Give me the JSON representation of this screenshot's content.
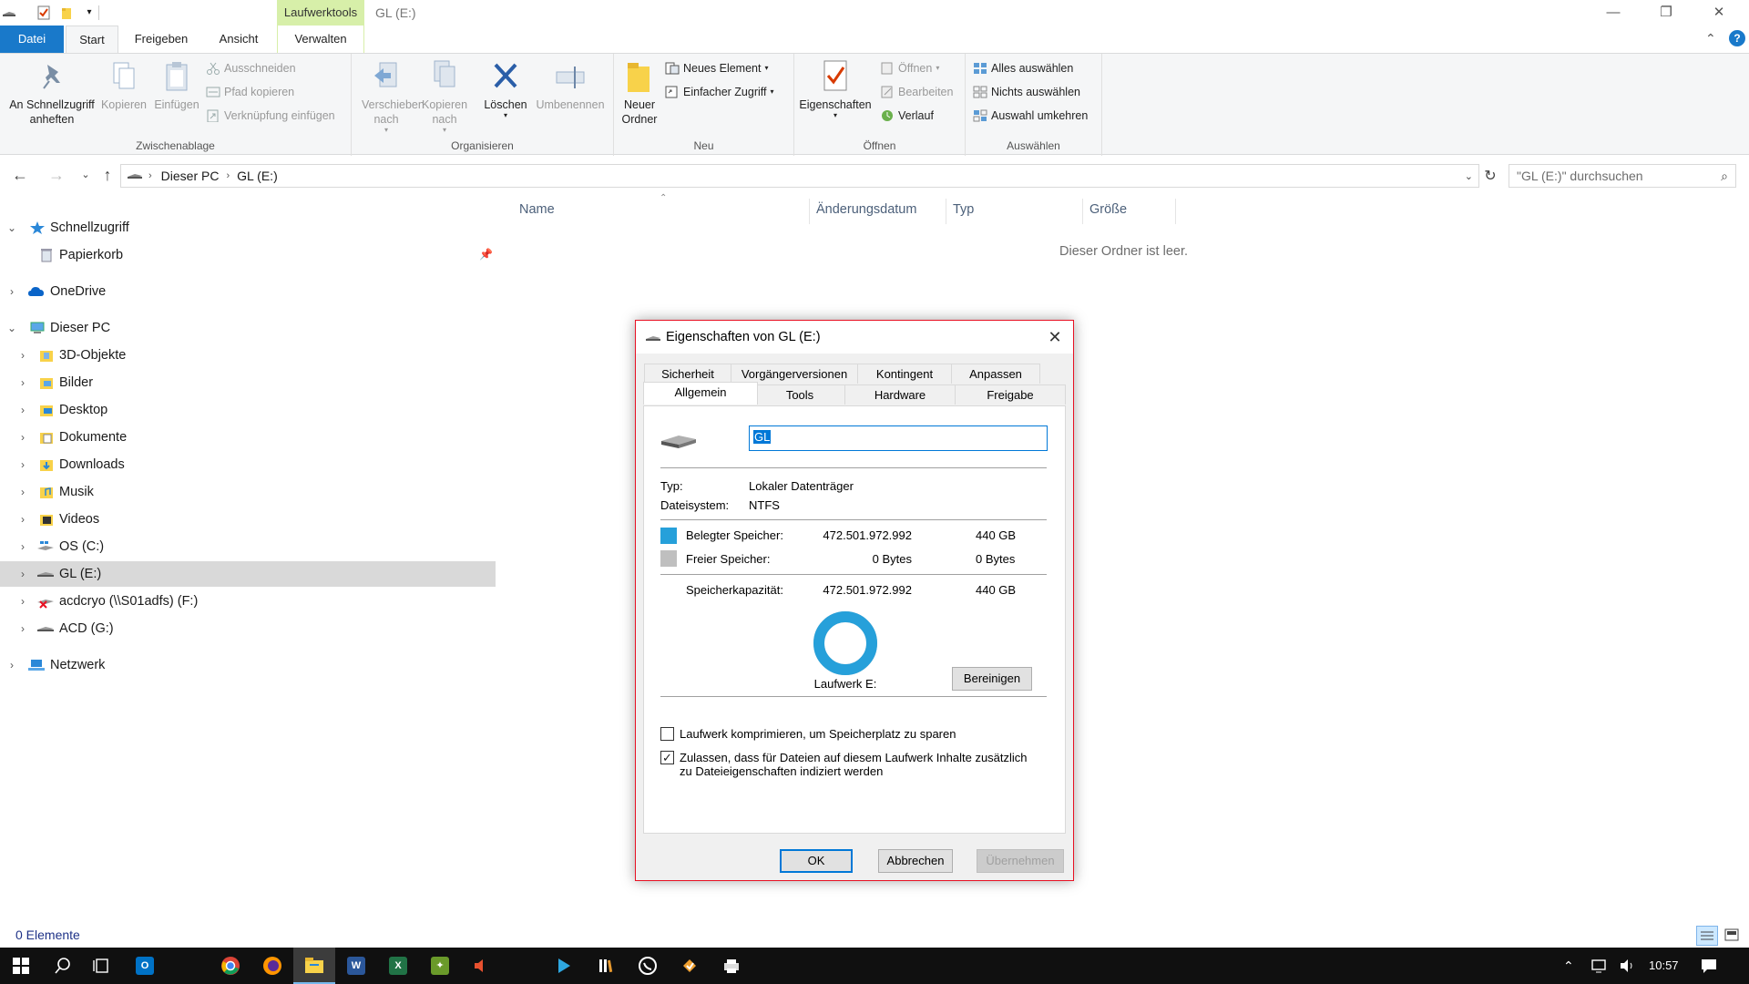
{
  "titlebar": {
    "context_tab": "Laufwerktools",
    "title": "GL (E:)"
  },
  "ribbon_tabs": [
    "Datei",
    "Start",
    "Freigeben",
    "Ansicht",
    "Verwalten"
  ],
  "ribbon": {
    "zwischenablage": {
      "label": "Zwischenablage",
      "pin": "An Schnellzugriff anheften",
      "copy": "Kopieren",
      "paste": "Einfügen",
      "cut": "Ausschneiden",
      "copy_path": "Pfad kopieren",
      "paste_shortcut": "Verknüpfung einfügen"
    },
    "organisieren": {
      "label": "Organisieren",
      "move_to": "Verschieben nach",
      "copy_to": "Kopieren nach",
      "delete": "Löschen",
      "rename": "Umbenennen"
    },
    "neu": {
      "label": "Neu",
      "new_folder": "Neuer Ordner",
      "new_item": "Neues Element",
      "easy_access": "Einfacher Zugriff"
    },
    "oeffnen": {
      "label": "Öffnen",
      "properties": "Eigenschaften",
      "open": "Öffnen",
      "edit": "Bearbeiten",
      "history": "Verlauf"
    },
    "auswaehlen": {
      "label": "Auswählen",
      "select_all": "Alles auswählen",
      "select_none": "Nichts auswählen",
      "invert": "Auswahl umkehren"
    }
  },
  "address": {
    "crumbs": [
      "Dieser PC",
      "GL (E:)"
    ],
    "search_placeholder": "\"GL (E:)\" durchsuchen"
  },
  "nav": {
    "quick_access": "Schnellzugriff",
    "recycle_bin": "Papierkorb",
    "onedrive": "OneDrive",
    "this_pc": "Dieser PC",
    "objects3d": "3D-Objekte",
    "pictures": "Bilder",
    "desktop": "Desktop",
    "documents": "Dokumente",
    "downloads": "Downloads",
    "music": "Musik",
    "videos": "Videos",
    "os_c": "OS (C:)",
    "gl_e": "GL (E:)",
    "acdcryo": "acdcryo (\\\\S01adfs) (F:)",
    "acd_g": "ACD (G:)",
    "network": "Netzwerk"
  },
  "filelist": {
    "columns": [
      "Name",
      "Änderungsdatum",
      "Typ",
      "Größe"
    ],
    "empty_message": "Dieser Ordner ist leer."
  },
  "status": {
    "item_count": "0 Elemente"
  },
  "taskbar": {
    "clock": "10:57"
  },
  "dialog": {
    "title": "Eigenschaften von GL (E:)",
    "tabs_top": [
      "Sicherheit",
      "Vorgängerversionen",
      "Kontingent",
      "Anpassen"
    ],
    "tabs_bottom": [
      "Allgemein",
      "Tools",
      "Hardware",
      "Freigabe"
    ],
    "name_value": "GL",
    "type_label": "Typ:",
    "type_value": "Lokaler Datenträger",
    "fs_label": "Dateisystem:",
    "fs_value": "NTFS",
    "used_label": "Belegter Speicher:",
    "used_bytes": "472.501.972.992",
    "used_gb": "440 GB",
    "free_label": "Freier Speicher:",
    "free_bytes": "0 Bytes",
    "free_gb": "0 Bytes",
    "capacity_label": "Speicherkapazität:",
    "capacity_bytes": "472.501.972.992",
    "capacity_gb": "440 GB",
    "drive_label": "Laufwerk E:",
    "cleanup_button": "Bereinigen",
    "compress_label": "Laufwerk komprimieren, um Speicherplatz zu sparen",
    "compress_checked": false,
    "index_label_line1": "Zulassen, dass für Dateien auf diesem Laufwerk Inhalte zusätzlich",
    "index_label_line2": "zu Dateieigenschaften indiziert werden",
    "index_checked": true,
    "ok": "OK",
    "cancel": "Abbrechen",
    "apply": "Übernehmen",
    "used_color": "#26a0da",
    "free_color": "#bfbfbf",
    "used_fraction": 1.0
  }
}
